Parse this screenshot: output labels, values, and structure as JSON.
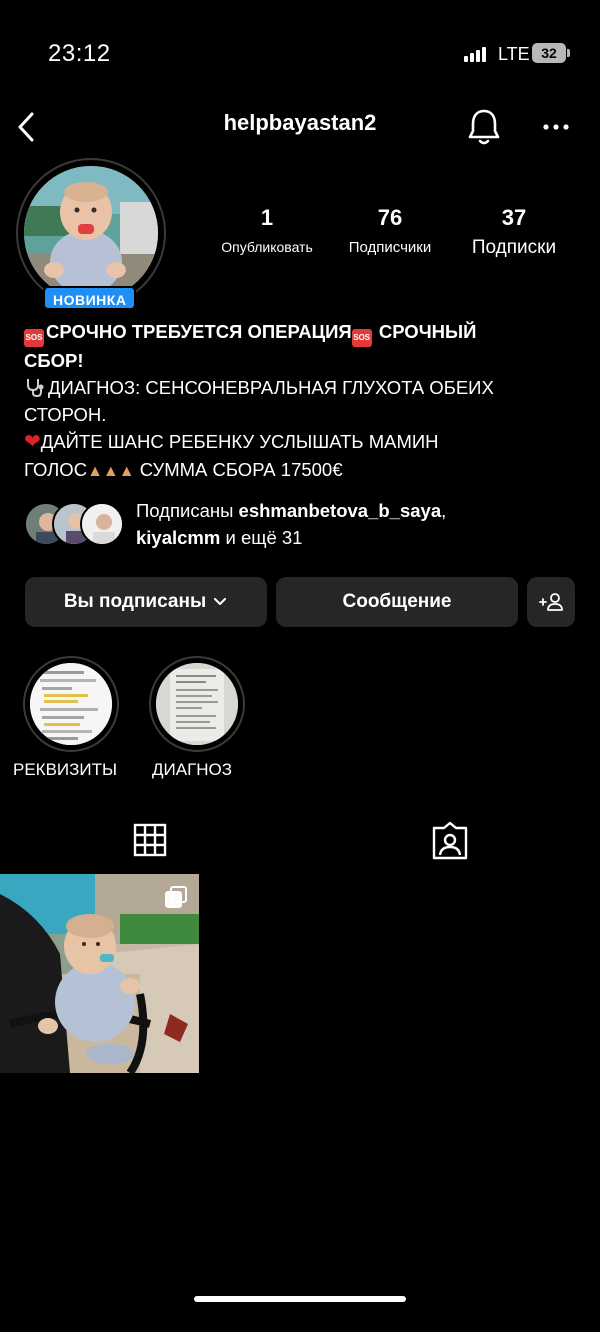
{
  "status_bar": {
    "time": "23:12",
    "network": "LTE",
    "battery": "32"
  },
  "header": {
    "username": "helpbayastan2"
  },
  "profile": {
    "badge": "НОВИНКА",
    "stats": [
      {
        "value": "1",
        "label": "Опубликовать"
      },
      {
        "value": "76",
        "label": "Подписчики"
      },
      {
        "value": "37",
        "label": "Подписки"
      }
    ],
    "bio": {
      "line1": "СРОЧНО ТРЕБУЕТСЯ ОПЕРАЦИЯ",
      "line1b": " СРОЧНЫЙ",
      "line2": "СБОР!",
      "line3": "ДИАГНОЗ: СЕНСОНЕВРАЛЬНАЯ ГЛУХОТА ОБЕИХ",
      "line4": "СТОРОН.",
      "line5": "ДАЙТЕ ШАНС РЕБЕНКУ УСЛЫШАТЬ МАМИН",
      "line6a": "ГОЛОС",
      "line6b": " СУММА СБОРА 17500€",
      "sos_label": "SOS"
    },
    "followed_by": {
      "prefix": "Подписаны ",
      "user1": "eshmanbetova_b_saya",
      "sep": ",",
      "user2": "kiyalcmm",
      "suffix": " и ещё 31"
    }
  },
  "actions": {
    "following_label": "Вы подписаны",
    "message_label": "Сообщение"
  },
  "highlights": [
    {
      "label": "РЕКВИЗИТЫ"
    },
    {
      "label": "ДИАГНОЗ"
    }
  ],
  "tabs": [
    {
      "icon": "grid-icon"
    },
    {
      "icon": "tagged-icon"
    }
  ],
  "posts": [
    {
      "type": "carousel"
    }
  ],
  "colors": {
    "accent": "#1f8ef5",
    "button_bg": "#262626",
    "background": "#000000"
  }
}
